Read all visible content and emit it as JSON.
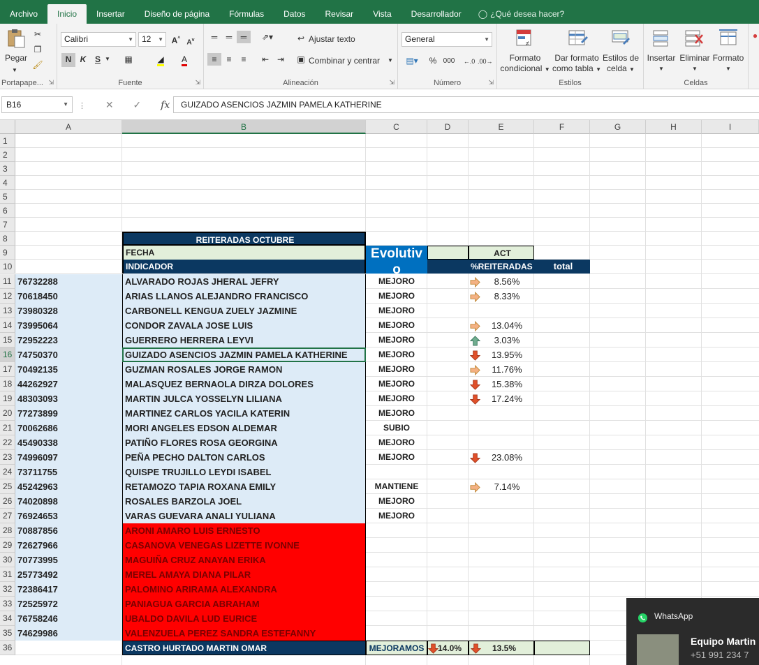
{
  "tabs": [
    "Archivo",
    "Inicio",
    "Insertar",
    "Diseño de página",
    "Fórmulas",
    "Datos",
    "Revisar",
    "Vista",
    "Desarrollador"
  ],
  "active_tab": "Inicio",
  "tell_me": "¿Qué desea hacer?",
  "ribbon": {
    "paste": "Pegar",
    "clipboard_label": "Portapape...",
    "font_name": "Calibri",
    "font_size": "12",
    "font_label": "Fuente",
    "bold": "N",
    "italic": "K",
    "underline": "S",
    "wrap_text": "Ajustar texto",
    "merge_center": "Combinar y centrar",
    "align_label": "Alineación",
    "number_format": "General",
    "percent": "%",
    "thousands": "000",
    "number_label": "Número",
    "cond_format_1": "Formato",
    "cond_format_2": "condicional",
    "table_format_1": "Dar formato",
    "table_format_2": "como tabla",
    "cell_styles_1": "Estilos de",
    "cell_styles_2": "celda",
    "styles_label": "Estilos",
    "insert": "Insertar",
    "delete": "Eliminar",
    "format": "Formato",
    "cells_label": "Celdas"
  },
  "formula_bar": {
    "name_box": "B16",
    "formula": "GUIZADO ASENCIOS JAZMIN PAMELA KATHERINE"
  },
  "columns": [
    "A",
    "B",
    "C",
    "D",
    "E",
    "F",
    "G",
    "H",
    "I"
  ],
  "selected_column": "B",
  "selected_row": 16,
  "header": {
    "title": "REITERADAS OCTUBRE",
    "fecha": "FECHA",
    "indicador": "INDICADOR",
    "evolutivo": "Evolutiv o",
    "act": "ACT",
    "reiteradas": "%REITERADAS",
    "total": "total"
  },
  "rows": [
    {
      "id": "76732288",
      "name": "ALVARADO ROJAS JHERAL JEFRY",
      "status": "MEJORO",
      "arrow": "right",
      "pct": "8.56%",
      "red": false
    },
    {
      "id": "70618450",
      "name": "ARIAS LLANOS ALEJANDRO FRANCISCO",
      "status": "MEJORO",
      "arrow": "right",
      "pct": "8.33%",
      "red": false
    },
    {
      "id": "73980328",
      "name": "CARBONELL KENGUA ZUELY JAZMINE",
      "status": "MEJORO",
      "arrow": "",
      "pct": "",
      "red": false
    },
    {
      "id": "73995064",
      "name": "CONDOR ZAVALA JOSE LUIS",
      "status": "MEJORO",
      "arrow": "right",
      "pct": "13.04%",
      "red": false
    },
    {
      "id": "72952223",
      "name": "GUERRERO HERRERA LEYVI",
      "status": "MEJORO",
      "arrow": "up",
      "pct": "3.03%",
      "red": false
    },
    {
      "id": "74750370",
      "name": "GUIZADO ASENCIOS JAZMIN PAMELA KATHERINE",
      "status": "MEJORO",
      "arrow": "down",
      "pct": "13.95%",
      "red": false
    },
    {
      "id": "70492135",
      "name": "GUZMAN ROSALES JORGE RAMON",
      "status": "MEJORO",
      "arrow": "right",
      "pct": "11.76%",
      "red": false
    },
    {
      "id": "44262927",
      "name": "MALASQUEZ BERNAOLA DIRZA DOLORES",
      "status": "MEJORO",
      "arrow": "down",
      "pct": "15.38%",
      "red": false
    },
    {
      "id": "48303093",
      "name": "MARTIN JULCA YOSSELYN LILIANA",
      "status": "MEJORO",
      "arrow": "down",
      "pct": "17.24%",
      "red": false
    },
    {
      "id": "77273899",
      "name": "MARTINEZ CARLOS YACILA KATERIN",
      "status": "MEJORO",
      "arrow": "",
      "pct": "",
      "red": false
    },
    {
      "id": "70062686",
      "name": "MORI ANGELES EDSON ALDEMAR",
      "status": "SUBIO",
      "arrow": "",
      "pct": "",
      "red": false
    },
    {
      "id": "45490338",
      "name": "PATIÑO FLORES ROSA GEORGINA",
      "status": "MEJORO",
      "arrow": "",
      "pct": "",
      "red": false
    },
    {
      "id": "74996097",
      "name": "PEÑA PECHO DALTON CARLOS",
      "status": "MEJORO",
      "arrow": "down",
      "pct": "23.08%",
      "red": false
    },
    {
      "id": "73711755",
      "name": "QUISPE TRUJILLO LEYDI ISABEL",
      "status": "",
      "arrow": "",
      "pct": "",
      "red": false
    },
    {
      "id": "45242963",
      "name": "RETAMOZO TAPIA ROXANA EMILY",
      "status": "MANTIENE",
      "arrow": "right",
      "pct": "7.14%",
      "red": false
    },
    {
      "id": "74020898",
      "name": "ROSALES BARZOLA JOEL",
      "status": "MEJORO",
      "arrow": "",
      "pct": "",
      "red": false
    },
    {
      "id": "76924653",
      "name": "VARAS GUEVARA ANALI YULIANA",
      "status": "MEJORO",
      "arrow": "",
      "pct": "",
      "red": false
    },
    {
      "id": "70887856",
      "name": "ARONI AMARO LUIS ERNESTO",
      "status": "",
      "arrow": "",
      "pct": "",
      "red": true
    },
    {
      "id": "72627966",
      "name": "CASANOVA VENEGAS LIZETTE IVONNE",
      "status": "",
      "arrow": "",
      "pct": "",
      "red": true
    },
    {
      "id": "70773995",
      "name": "MAGUIÑA CRUZ ANAYAN ERIKA",
      "status": "",
      "arrow": "",
      "pct": "",
      "red": true
    },
    {
      "id": "25773492",
      "name": "MEREL AMAYA DIANA PILAR",
      "status": "",
      "arrow": "",
      "pct": "",
      "red": true
    },
    {
      "id": "72386417",
      "name": "PALOMINO ARIRAMA ALEXANDRA",
      "status": "",
      "arrow": "",
      "pct": "",
      "red": true
    },
    {
      "id": "72525972",
      "name": "PANIAGUA GARCIA ABRAHAM",
      "status": "",
      "arrow": "",
      "pct": "",
      "red": true
    },
    {
      "id": "76758246",
      "name": "UBALDO DAVILA LUD EURICE",
      "status": "",
      "arrow": "",
      "pct": "",
      "red": true
    },
    {
      "id": "74629986",
      "name": "VALENZUELA PEREZ SANDRA ESTEFANNY",
      "status": "",
      "arrow": "",
      "pct": "",
      "red": true
    }
  ],
  "footer": {
    "name": "CASTRO HURTADO MARTIN OMAR",
    "status": "MEJORAMOS",
    "d_pct": "14.0%",
    "e_pct": "13.5%"
  },
  "whatsapp": {
    "title": "WhatsApp",
    "name": "Equipo Martin",
    "phone": "+51 991 234 7"
  },
  "colors": {
    "excel_green": "#217346",
    "navy": "#0b3861",
    "light_green": "#e2efda",
    "light_blue": "#ddebf7",
    "red_fill": "#ff0000",
    "evolutivo_blue": "#0070c0",
    "arrow_orange": "#f4b183",
    "arrow_red": "#e0502a",
    "arrow_green": "#70ad8f"
  }
}
